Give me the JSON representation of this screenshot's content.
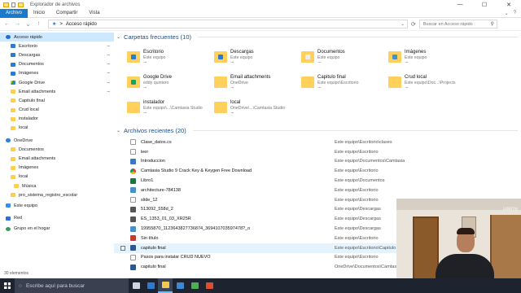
{
  "window": {
    "title": "Explorador de archivos",
    "minimize": "—",
    "maximize": "☐",
    "close": "✕"
  },
  "ribbon": {
    "tabs": [
      "Archivo",
      "Inicio",
      "Compartir",
      "Vista"
    ],
    "collapse": "⌄",
    "help": "?"
  },
  "address": {
    "back": "←",
    "forward": "→",
    "up_dropdown": "⌄",
    "up": "↑",
    "path": "Acceso rápido",
    "separator": ">",
    "search_placeholder": "Buscar en Acceso rápido",
    "refresh": "⟳",
    "search_icon": "⚲"
  },
  "sidebar": {
    "quick_access": "Acceso rápido",
    "pinned": [
      {
        "label": "Escritorio",
        "icon": "desktop-icon",
        "pinned": true
      },
      {
        "label": "Descargas",
        "icon": "downloads-icon",
        "pinned": true
      },
      {
        "label": "Documentos",
        "icon": "documents-icon",
        "pinned": true
      },
      {
        "label": "Imágenes",
        "icon": "pictures-icon",
        "pinned": true
      },
      {
        "label": "Google Drive",
        "icon": "google-drive-icon",
        "pinned": true
      },
      {
        "label": "Email attachments",
        "icon": "folder-icon",
        "pinned": true
      },
      {
        "label": "Capitulo final",
        "icon": "folder-icon",
        "pinned": false
      },
      {
        "label": "Crud local",
        "icon": "folder-icon",
        "pinned": false
      },
      {
        "label": "instalador",
        "icon": "folder-icon",
        "pinned": false
      },
      {
        "label": "local",
        "icon": "folder-icon",
        "pinned": false
      }
    ],
    "onedrive": "OneDrive",
    "onedrive_items": [
      {
        "label": "Documentos",
        "deep": false
      },
      {
        "label": "Email attachments",
        "deep": false
      },
      {
        "label": "Imágenes",
        "deep": false
      },
      {
        "label": "local",
        "deep": false
      },
      {
        "label": "Música",
        "deep": true
      },
      {
        "label": "pro_sistema_registro_escolar",
        "deep": false
      }
    ],
    "this_pc": "Este equipo",
    "network": "Red",
    "homegroup": "Grupo en el hogar",
    "pin_glyph": "📌"
  },
  "status": {
    "items": "30 elementos"
  },
  "main": {
    "frequent_header": "Carpetas frecuentes (10)",
    "frequent": [
      {
        "name": "Escritorio",
        "sub": "Este equipo",
        "overlay": "#2a7bd4"
      },
      {
        "name": "Descargas",
        "sub": "Este equipo",
        "overlay": "#2a7bd4"
      },
      {
        "name": "Documentos",
        "sub": "Este equipo",
        "overlay": "#eeeeee"
      },
      {
        "name": "Imágenes",
        "sub": "Este equipo",
        "overlay": "#4a90c8"
      },
      {
        "name": "Google Drive",
        "sub": "eddy quintero",
        "overlay": "#1ba15a"
      },
      {
        "name": "Email attachments",
        "sub": "OneDrive",
        "overlay": ""
      },
      {
        "name": "Capitulo final",
        "sub": "Este equipo\\Escritorio",
        "overlay": ""
      },
      {
        "name": "Crud local",
        "sub": "Este equipo\\Doc...\\Projects",
        "overlay": ""
      },
      {
        "name": "instalador",
        "sub": "Este equipo\\...\\Camtasia Studio",
        "overlay": ""
      },
      {
        "name": "local",
        "sub": "OneDrive\\...\\Camtasia Studio",
        "overlay": ""
      }
    ],
    "recent_header": "Archivos recientes (20)",
    "recent": [
      {
        "name": "Clase_datos.cs",
        "path": "Este equipo\\Escritorio\\clases",
        "icon": "doc"
      },
      {
        "name": "leer",
        "path": "Este equipo\\Escritorio",
        "icon": "doc"
      },
      {
        "name": "Introduccion",
        "path": "Este equipo\\Documentos\\Camtasia Studio\\Introduccion",
        "icon": "blue"
      },
      {
        "name": "Camtasia Studio 9 Crack Key & Keygen Free Download",
        "path": "Este equipo\\Escritorio",
        "icon": "chrome"
      },
      {
        "name": "Libro1",
        "path": "Este equipo\\Documentos",
        "icon": "excel"
      },
      {
        "name": "architecture-784138",
        "path": "Este equipo\\Escritorio",
        "icon": "img"
      },
      {
        "name": "slide_12",
        "path": "Este equipo\\Escritorio",
        "icon": "doc"
      },
      {
        "name": "513092_558d_2",
        "path": "Este equipo\\Descargas",
        "icon": "vid"
      },
      {
        "name": "ES_1353_01_03_XR25R",
        "path": "Este equipo\\Descargas",
        "icon": "vid"
      },
      {
        "name": "19955870_1123643827736874_369410703597478?_o",
        "path": "Este equipo\\Descargas",
        "icon": "img"
      },
      {
        "name": "Sin título",
        "path": "Este equipo\\Escritorio",
        "icon": "pdf"
      },
      {
        "name": "capitulo final",
        "path": "Este equipo\\Escritorio\\Capitulo final",
        "icon": "word",
        "highlight": true
      },
      {
        "name": "Pasos para instalar CRUD NUEVO",
        "path": "Este equipo\\Escritorio",
        "icon": "doc"
      },
      {
        "name": "capitulo final",
        "path": "OneDrive\\Documentos\\Camtasia Studio",
        "icon": "word"
      }
    ]
  },
  "taskbar": {
    "search_placeholder": "Escribe aquí para buscar",
    "search_glyph": "○",
    "apps": [
      {
        "name": "task-view-icon",
        "color": "#cfd6e0"
      },
      {
        "name": "edge-icon",
        "color": "#2d7ad6"
      },
      {
        "name": "file-explorer-icon",
        "color": "#f2c94c"
      },
      {
        "name": "store-icon",
        "color": "#3a88d8"
      },
      {
        "name": "chrome-icon",
        "color": "#4caf50"
      },
      {
        "name": "camtasia-icon",
        "color": "#e04c2c"
      }
    ]
  },
  "webcam": {
    "brand_top": "udemy",
    "brand_bottom": "udemy"
  },
  "colors": {
    "accent": "#1979ca",
    "selection": "#cde8ff",
    "header_text": "#1e4e8c"
  }
}
